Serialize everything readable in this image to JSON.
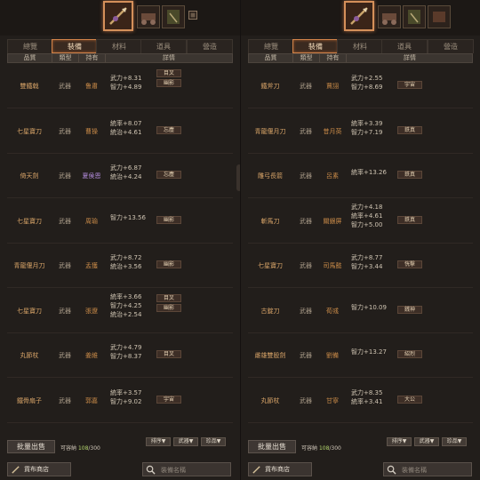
{
  "colors": {
    "accent": "#d2844a",
    "name": "#d8a468",
    "holder": "#c88a48",
    "purple_holder": "#b08ad8",
    "capacity_green": "#b4d66e"
  },
  "icons": [
    "spear-icon",
    "cart-icon",
    "book-icon",
    "scroll-icon",
    "small-square-icon"
  ],
  "tabs": [
    "總覽",
    "裝備",
    "材料",
    "道具",
    "營造"
  ],
  "columns": [
    "品質",
    "類型",
    "持有",
    "詳情"
  ],
  "left": {
    "rows": [
      {
        "name": "雙鐵戟",
        "type": "武器",
        "holder": "鲁肅",
        "holder_color": "orange",
        "stats": [
          "武力+8.31",
          "智力+4.89"
        ],
        "chips": [
          "目叉",
          "幽影"
        ]
      },
      {
        "name": "七星寶刀",
        "type": "武器",
        "holder": "曹操",
        "holder_color": "orange",
        "stats": [
          "統率+8.07",
          "統治+4.61"
        ],
        "chips": [
          "忘塵"
        ]
      },
      {
        "name": "倚天劍",
        "type": "武器",
        "holder": "夏侯恩",
        "holder_color": "purple",
        "stats": [
          "武力+6.87",
          "統治+4.24"
        ],
        "chips": [
          "忘塵"
        ]
      },
      {
        "name": "七星寶刀",
        "type": "武器",
        "holder": "周瑜",
        "holder_color": "orange",
        "stats": [
          "智力+13.56"
        ],
        "chips": [
          "幽影"
        ]
      },
      {
        "name": "青龍偃月刀",
        "type": "武器",
        "holder": "孟獲",
        "holder_color": "orange",
        "stats": [
          "武力+8.72",
          "統治+3.56"
        ],
        "chips": [
          "幽影"
        ]
      },
      {
        "name": "七星寶刀",
        "type": "武器",
        "holder": "張遼",
        "holder_color": "orange",
        "stats": [
          "統率+3.66",
          "智力+4.25",
          "統治+2.54"
        ],
        "chips": [
          "目叉",
          "幽影"
        ]
      },
      {
        "name": "丸節杖",
        "type": "武器",
        "holder": "姜維",
        "holder_color": "orange",
        "stats": [
          "武力+4.79",
          "智力+8.37"
        ],
        "chips": [
          "目叉"
        ]
      },
      {
        "name": "鐵骨扇子",
        "type": "武器",
        "holder": "郭嘉",
        "holder_color": "orange",
        "stats": [
          "統率+3.57",
          "智力+9.02"
        ],
        "chips": [
          "宇宙"
        ]
      }
    ],
    "footer": {
      "bulk_sell": "批量出售",
      "capacity_label": "可容納",
      "capacity_count": "108",
      "capacity_total": "/300",
      "filters": [
        "排序▼",
        "武器▼",
        "珍品▼"
      ],
      "shop_label": "貨布商店",
      "search_placeholder": "裝備名稱"
    }
  },
  "right": {
    "rows": [
      {
        "name": "鐵斧刀",
        "type": "武器",
        "holder": "賈詡",
        "holder_color": "orange",
        "stats": [
          "武力+2.55",
          "智力+8.69"
        ],
        "chips": [
          "宇宙"
        ]
      },
      {
        "name": "青龍偃月刀",
        "type": "武器",
        "holder": "昔月英",
        "holder_color": "orange",
        "stats": [
          "統率+3.39",
          "智力+7.19"
        ],
        "chips": [
          "鉄真"
        ]
      },
      {
        "name": "雕弓長箭",
        "type": "武器",
        "holder": "呂素",
        "holder_color": "orange",
        "stats": [
          "統率+13.26"
        ],
        "chips": [
          "鉄真"
        ]
      },
      {
        "name": "斬馬刀",
        "type": "武器",
        "holder": "關銀屏",
        "holder_color": "orange",
        "stats": [
          "武力+4.18",
          "統率+4.61",
          "智力+5.00"
        ],
        "chips": [
          "鉄真"
        ]
      },
      {
        "name": "七星寶刀",
        "type": "武器",
        "holder": "司馬懿",
        "holder_color": "orange",
        "stats": [
          "武力+8.77",
          "智力+3.44"
        ],
        "chips": [
          "恍擊"
        ]
      },
      {
        "name": "古錠刀",
        "type": "武器",
        "holder": "荀彧",
        "holder_color": "orange",
        "stats": [
          "智力+10.09"
        ],
        "chips": [
          "銭神"
        ]
      },
      {
        "name": "雌雄雙股劍",
        "type": "武器",
        "holder": "劉備",
        "holder_color": "orange",
        "stats": [
          "智力+13.27"
        ],
        "chips": [
          "紹烈"
        ]
      },
      {
        "name": "丸節杖",
        "type": "武器",
        "holder": "甘寧",
        "holder_color": "orange",
        "stats": [
          "武力+8.35",
          "統率+3.41"
        ],
        "chips": [
          "大公"
        ]
      }
    ],
    "footer": {
      "bulk_sell": "批量出售",
      "capacity_label": "可容納",
      "capacity_count": "108",
      "capacity_total": "/300",
      "filters": [
        "排序▼",
        "武器▼",
        "珍品▼"
      ],
      "shop_label": "貨布商店",
      "search_placeholder": "裝備名稱"
    }
  }
}
